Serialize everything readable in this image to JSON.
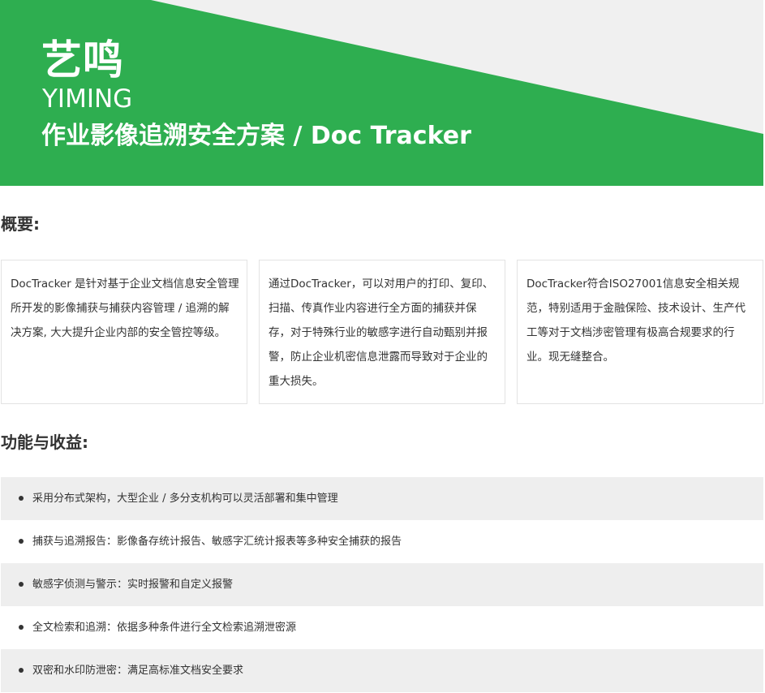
{
  "banner": {
    "brand_cn": "艺鸣",
    "brand_en": "YIMING",
    "product_title": "作业影像追溯安全方案 / Doc Tracker",
    "colors": {
      "green": "#2eae50",
      "light_gray": "#f0f0f0"
    }
  },
  "overview": {
    "heading": "概要:",
    "cards": [
      {
        "text": "DocTracker 是针对基于企业文档信息安全管理所开发的影像捕获与捕获内容管理 / 追溯的解决方案, 大大提升企业内部的安全管控等级。"
      },
      {
        "text": "通过DocTracker，可以对用户的打印、复印、扫描、传真作业内容进行全方面的捕获并保存，对于特殊行业的敏感字进行自动甄别并报警，防止企业机密信息泄露而导致对于企业的重大损失。"
      },
      {
        "text": "DocTracker符合ISO27001信息安全相关规范，特别适用于金融保险、技术设计、生产代工等对于文档涉密管理有极高合规要求的行业。现无缝整合。"
      }
    ]
  },
  "features": {
    "heading": "功能与收益:",
    "items": [
      {
        "text": "采用分布式架构，大型企业 / 多分支机构可以灵活部署和集中管理"
      },
      {
        "text": "捕获与追溯报告：影像备存统计报告、敏感字汇统计报表等多种安全捕获的报告"
      },
      {
        "text": "敏感字侦测与警示：实时报警和自定义报警"
      },
      {
        "text": "全文检索和追溯：依据多种条件进行全文检索追溯泄密源"
      },
      {
        "text": "双密和水印防泄密：满足高标准文档安全要求"
      }
    ]
  }
}
